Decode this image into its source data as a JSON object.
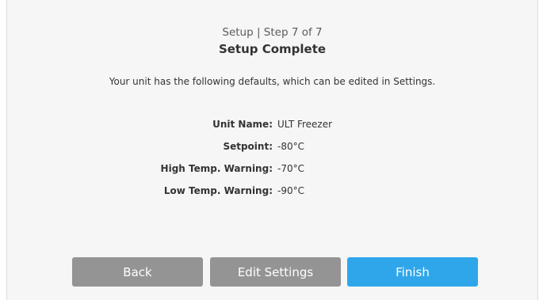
{
  "header": {
    "step": "Setup | Step 7 of 7",
    "title": "Setup Complete"
  },
  "description": "Your unit has the following defaults, which can be edited in Settings.",
  "defaults": [
    {
      "label": "Unit Name:",
      "value": "ULT Freezer"
    },
    {
      "label": "Setpoint:",
      "value": "-80°C"
    },
    {
      "label": "High Temp. Warning:",
      "value": "-70°C"
    },
    {
      "label": "Low Temp. Warning:",
      "value": "-90°C"
    }
  ],
  "buttons": {
    "back": "Back",
    "edit": "Edit Settings",
    "finish": "Finish"
  },
  "colors": {
    "panel_bg": "#f6f6f6",
    "button_gray": "#949494",
    "button_primary": "#2fa6ea"
  }
}
